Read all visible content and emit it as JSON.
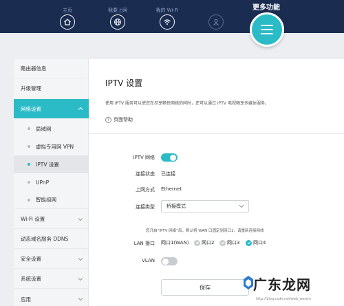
{
  "header": {
    "nav": [
      {
        "label": "主页",
        "icon": "home-icon"
      },
      {
        "label": "我要上网",
        "icon": "globe-icon"
      },
      {
        "label": "我的 Wi-Fi",
        "icon": "wifi-icon"
      },
      {
        "label": "",
        "icon": "user-icon"
      }
    ],
    "more_label": "更多功能",
    "more_icon": "menu-icon"
  },
  "sidebar": {
    "items": [
      {
        "label": "路由器信息"
      },
      {
        "label": "升级管理"
      },
      {
        "label": "网络设置"
      },
      {
        "label": "局域网"
      },
      {
        "label": "虚拟专用网 VPN"
      },
      {
        "label": "IPTV 设置"
      },
      {
        "label": "UPnP"
      },
      {
        "label": "智能组网"
      },
      {
        "label": "Wi-Fi 设置"
      },
      {
        "label": "动态域名服务 DDNS"
      },
      {
        "label": "安全设置"
      },
      {
        "label": "系统设置"
      },
      {
        "label": "应用"
      }
    ]
  },
  "content": {
    "title": "IPTV 设置",
    "description": "使用 IPTV 服务可以使您在尽享畅快网络的同时，还可以通过 IPTV 电视畅享多媒体服务。",
    "help_label": "页面帮助",
    "fields": {
      "iptv_label": "IPTV 网络",
      "iptv_enabled": true,
      "status_label": "连接状态",
      "status_value": "已连接",
      "uplink_label": "上网方式",
      "uplink_value": "Ethernet",
      "conn_type_label": "连接类型",
      "conn_type_value": "桥接模式",
      "note": "您开启“IPTV 网络”后，默认将 WAN 口固定到网口1，请重新连接网线",
      "lan_label": "LAN 接口",
      "ports": [
        {
          "label": "网口1(WAN)",
          "checked": false
        },
        {
          "label": "网口2",
          "checked": false
        },
        {
          "label": "网口3",
          "checked": false
        },
        {
          "label": "网口4",
          "checked": true
        }
      ],
      "vlan_label": "VLAN",
      "vlan_enabled": false
    },
    "save_label": "保存"
  },
  "watermark": {
    "text": "广东龙网",
    "url": "http://blog.csdn.net/web_weixin"
  },
  "colors": {
    "header_bg": "#1a2c50",
    "accent": "#2bbbc7"
  }
}
